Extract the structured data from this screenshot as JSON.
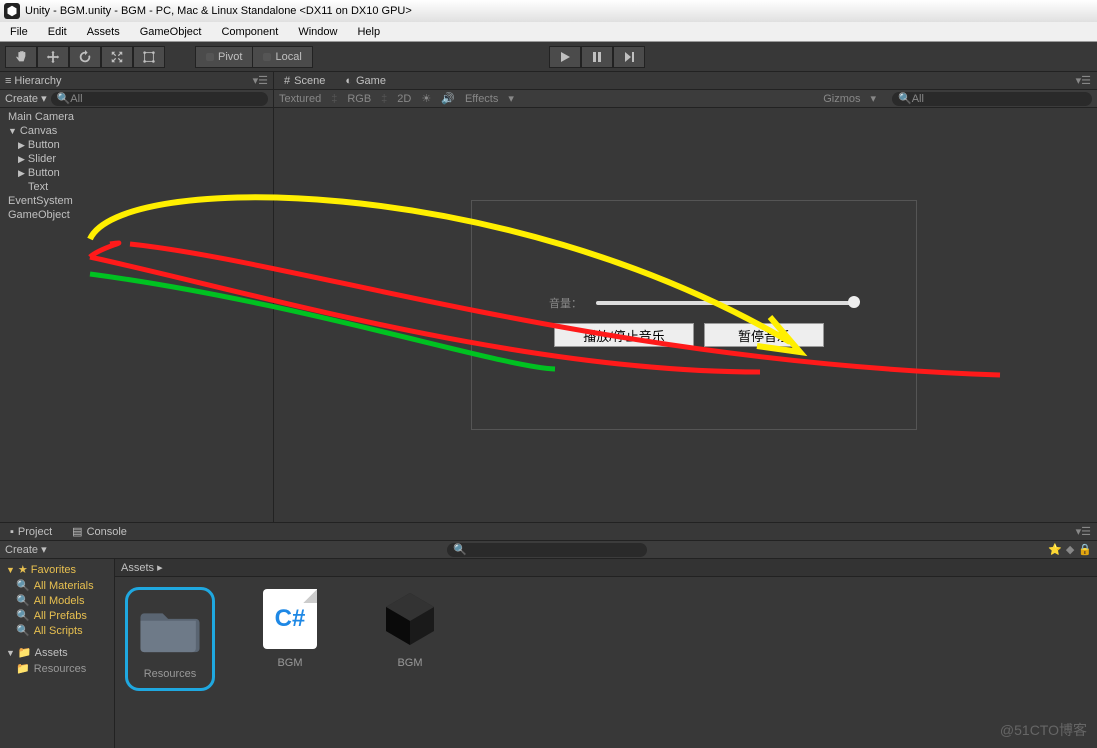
{
  "titlebar": {
    "text": "Unity - BGM.unity - BGM - PC, Mac & Linux Standalone <DX11 on DX10 GPU>"
  },
  "menu": [
    "File",
    "Edit",
    "Assets",
    "GameObject",
    "Component",
    "Window",
    "Help"
  ],
  "toolbar": {
    "pivot": "Pivot",
    "local": "Local"
  },
  "hierarchy": {
    "title": "Hierarchy",
    "create": "Create ▾",
    "search_placeholder": "All",
    "items": [
      {
        "label": "Main Camera",
        "indent": 0
      },
      {
        "label": "Canvas",
        "indent": 0,
        "caret": "▼"
      },
      {
        "label": "Button",
        "indent": 1,
        "caret": "▶"
      },
      {
        "label": "Slider",
        "indent": 1,
        "caret": "▶"
      },
      {
        "label": "Button",
        "indent": 1,
        "caret": "▶"
      },
      {
        "label": "Text",
        "indent": 1
      },
      {
        "label": "EventSystem",
        "indent": 0
      },
      {
        "label": "GameObject",
        "indent": 0
      }
    ]
  },
  "scene": {
    "tab_scene": "Scene",
    "tab_game": "Game",
    "toolbar": {
      "shading": "Textured",
      "render": "RGB",
      "mode2d": "2D",
      "effects": "Effects",
      "gizmos": "Gizmos",
      "search_placeholder": "All"
    },
    "game_ui": {
      "slider_label": "音量：",
      "play_stop": "播放/停止音乐",
      "pause": "暂停音乐"
    }
  },
  "project": {
    "tab_project": "Project",
    "tab_console": "Console",
    "create": "Create ▾",
    "favorites": "Favorites",
    "fav_items": [
      "All Materials",
      "All Models",
      "All Prefabs",
      "All Scripts"
    ],
    "assets_root": "Assets",
    "assets_children": [
      "Resources"
    ],
    "breadcrumb": "Assets  ▸",
    "grid": [
      {
        "label": "Resources",
        "type": "folder",
        "highlighted": true
      },
      {
        "label": "BGM",
        "type": "cs"
      },
      {
        "label": "BGM",
        "type": "scene"
      }
    ]
  },
  "watermark": "@51CTO博客"
}
